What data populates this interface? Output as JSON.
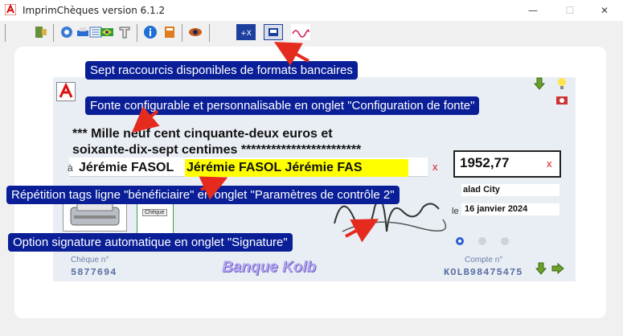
{
  "window": {
    "title": "ImprimChèques version 6.1.2",
    "minimize": "—",
    "maximize": "☐",
    "close": "✕"
  },
  "annotations": {
    "formats": "Sept raccourcis disponibles de formats bancaires",
    "fonte": "Fonte configurable et personnalisable en onglet \"Configuration de fonte\"",
    "repetition": "Répétition tags ligne \"bénéficiaire\" en onglet \"Paramètres de contrôle 2\"",
    "signature": "Option signature automatique en onglet \"Signature\""
  },
  "cheque": {
    "amount_words_line1": "*** Mille neuf cent cinquante-deux euros et",
    "amount_words_line2": "soixante-dix-sept centimes ************************",
    "payee_prefix": "à",
    "payee_name": "Jérémie FASOL",
    "payee_repeat": "Jérémie FASOL Jérémie FAS",
    "clear_mark": "x",
    "amount": "1952,77",
    "place": "alad City",
    "date_prefix": "le",
    "date": "16 janvier 2024",
    "cheque_no_label": "Chèque n°",
    "cheque_no": "5877694",
    "bank_name": "Banque Kolb",
    "account_label": "Compte n°",
    "account": "KOLB98475475",
    "mini_cheque_label": "Chèque"
  },
  "colors": {
    "note_bg": "#0a1f97",
    "arrow": "#e52b1e",
    "highlight": "#ffff00",
    "bank": "#b4a6f0"
  }
}
